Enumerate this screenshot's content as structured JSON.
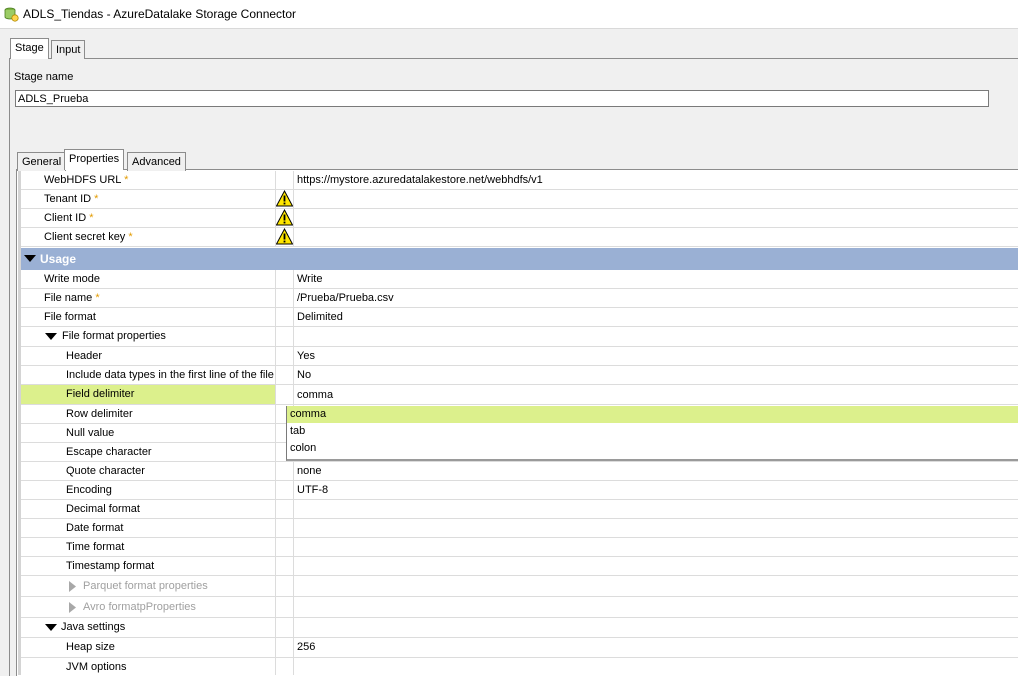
{
  "window": {
    "title": "ADLS_Tiendas - AzureDatalake Storage Connector",
    "icon": "connector-stage-icon"
  },
  "top_tabs": [
    {
      "label": "Stage",
      "active": true
    },
    {
      "label": "Input",
      "active": false
    }
  ],
  "stage": {
    "label": "Stage name",
    "value": "ADLS_Prueba"
  },
  "sub_tabs": [
    {
      "label": "General"
    },
    {
      "label": "Properties",
      "active": true
    },
    {
      "label": "Advanced"
    }
  ],
  "properties": {
    "webhdfs_url": {
      "label": "WebHDFS URL",
      "required": "*",
      "value": "https://mystore.azuredatalakestore.net/webhdfs/v1"
    },
    "tenant_id": {
      "label": "Tenant ID",
      "required": "*",
      "value": ""
    },
    "client_id": {
      "label": "Client ID",
      "required": "*",
      "value": ""
    },
    "client_secret": {
      "label": "Client secret key",
      "required": "*",
      "value": ""
    },
    "usage_section": "Usage",
    "write_mode": {
      "label": "Write mode",
      "value": "Write"
    },
    "file_name": {
      "label": "File name",
      "required": "*",
      "value": "/Prueba/Prueba.csv"
    },
    "file_format": {
      "label": "File format",
      "value": "Delimited"
    },
    "file_format_props": {
      "label": "File format properties"
    },
    "header": {
      "label": "Header",
      "value": "Yes"
    },
    "include_types": {
      "label": "Include data types in the first line of the file",
      "value": "No"
    },
    "field_delimiter": {
      "label": "Field delimiter",
      "value": "comma"
    },
    "row_delimiter": {
      "label": "Row delimiter"
    },
    "null_value": {
      "label": "Null value"
    },
    "escape_char": {
      "label": "Escape character"
    },
    "quote_char": {
      "label": "Quote character",
      "value": "none"
    },
    "encoding": {
      "label": "Encoding",
      "value": "UTF-8"
    },
    "decimal_format": {
      "label": "Decimal format",
      "value": ""
    },
    "date_format": {
      "label": "Date format",
      "value": ""
    },
    "time_format": {
      "label": "Time format",
      "value": ""
    },
    "timestamp_format": {
      "label": "Timestamp format",
      "value": ""
    },
    "parquet_props": {
      "label": "Parquet format properties"
    },
    "avro_props": {
      "label": "Avro formatpProperties"
    },
    "java_settings": {
      "label": "Java settings"
    },
    "heap_size": {
      "label": "Heap size",
      "value": "256"
    },
    "jvm_options": {
      "label": "JVM options",
      "value": ""
    }
  },
  "delimiter_dropdown": {
    "options": [
      "comma",
      "tab",
      "colon"
    ],
    "selected": "comma"
  },
  "colors": {
    "section_header": "#9ab0d4",
    "highlight": "#dcf08c",
    "required_star": "#e39b00",
    "warning": "#ffe600"
  }
}
